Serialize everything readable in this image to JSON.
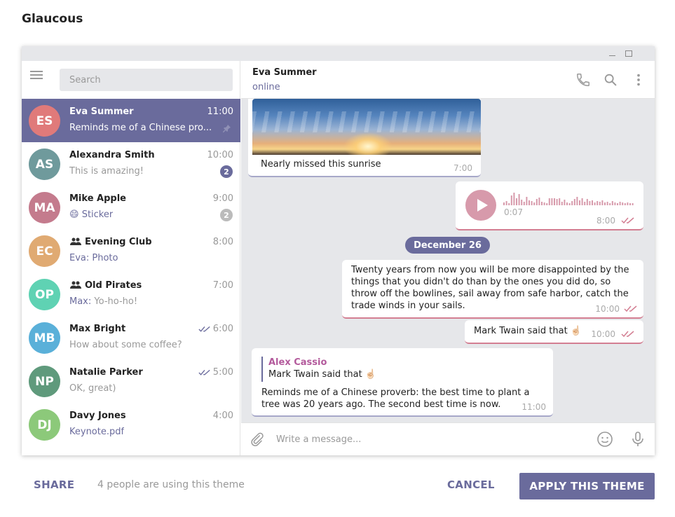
{
  "page": {
    "title": "Glaucous"
  },
  "sidebar": {
    "search_placeholder": "Search",
    "chats": [
      {
        "initials": "ES",
        "avatar_color": "#e07a7a",
        "name": "Eva Summer",
        "time": "11:00",
        "preview": "Reminds me of a Chinese pro...",
        "pinned": true,
        "active": true
      },
      {
        "initials": "AS",
        "avatar_color": "#6f9a9c",
        "name": "Alexandra Smith",
        "time": "10:00",
        "preview": "This is amazing!",
        "unread": "2"
      },
      {
        "initials": "MA",
        "avatar_color": "#c47b8d",
        "name": "Mike Apple",
        "time": "9:00",
        "preview_emoji": "😄",
        "preview": "Sticker",
        "unread": "2",
        "muted": true
      },
      {
        "initials": "EC",
        "avatar_color": "#e0aa72",
        "name": "Evening Club",
        "time": "8:00",
        "preview": "Eva: Photo",
        "group": true
      },
      {
        "initials": "OP",
        "avatar_color": "#5fd2b3",
        "name": "Old Pirates",
        "time": "7:00",
        "preview_sender": "Max:",
        "preview": "Yo-ho-ho!",
        "group": true
      },
      {
        "initials": "MB",
        "avatar_color": "#5ab0d9",
        "name": "Max Bright",
        "time": "6:00",
        "preview": "How about some coffee?",
        "read": true
      },
      {
        "initials": "NP",
        "avatar_color": "#5f9a7c",
        "name": "Natalie Parker",
        "time": "5:00",
        "preview": "OK, great)",
        "read": true
      },
      {
        "initials": "DJ",
        "avatar_color": "#8cc97a",
        "name": "Davy Jones",
        "time": "4:00",
        "preview": "Keynote.pdf"
      }
    ]
  },
  "header": {
    "name": "Eva Summer",
    "status": "online"
  },
  "messages": {
    "photo_caption": "Nearly missed this sunrise",
    "photo_time": "7:00",
    "voice_duration": "0:07",
    "voice_time": "8:00",
    "date_separator": "December 26",
    "quote_text": "Twenty years from now you will be more disappointed by the things that you didn't do than by the ones you did do, so throw off the bowlines, sail away from safe harbor, catch the trade winds in your sails.",
    "quote_time": "10:00",
    "twain_text": "Mark Twain said that ☝🏻",
    "twain_time": "10:00",
    "reply_author": "Alex Cassio",
    "reply_quote": "Mark Twain said that ☝🏻",
    "reply_text": "Reminds me of a Chinese proverb: the best time to plant a tree was 20 years ago. The second best time is now.",
    "reply_time": "11:00"
  },
  "composer": {
    "placeholder": "Write a message..."
  },
  "footer": {
    "share_label": "SHARE",
    "usage_text": "4 people are using this theme",
    "cancel_label": "CANCEL",
    "apply_label": "APPLY THIS THEME"
  },
  "colors": {
    "accent": "#6a6b9c",
    "outgoing_border": "#d37e92",
    "background": "#e6e7ea"
  }
}
